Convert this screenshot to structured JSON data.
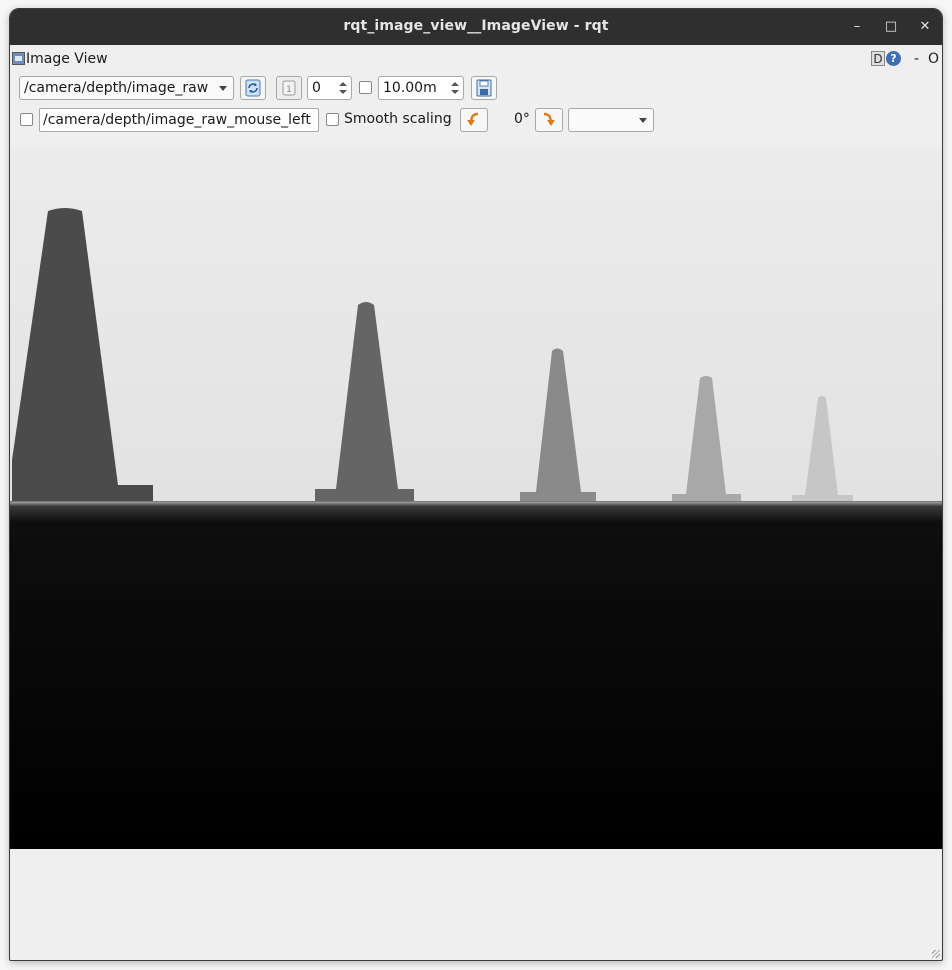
{
  "window": {
    "title": "rqt_image_view__ImageView - rqt",
    "controls": {
      "minimize": "–",
      "maximize": "□",
      "close": "✕"
    }
  },
  "panel": {
    "title": "Image View",
    "corner_d": "D",
    "corner_help": "?",
    "corner_dash": "-",
    "corner_o": "O"
  },
  "toolbar": {
    "topic": "/camera/depth/image_raw",
    "spin_value": "0",
    "max_depth": "10.00m",
    "mouse_topic": "/camera/depth/image_raw_mouse_left",
    "smooth_scaling_label": "Smooth scaling",
    "smooth_scaling_checked": false,
    "rotation": "0°",
    "zoom_select": ""
  },
  "icons": {
    "refresh": "refresh-icon",
    "zoom1": "zoom-1-icon",
    "save": "save-icon",
    "rotate_left": "rotate-left-icon",
    "rotate_right": "rotate-right-icon"
  },
  "colors": {
    "titlebar": "#2f2f2f",
    "accent_orange": "#e07a1a"
  }
}
